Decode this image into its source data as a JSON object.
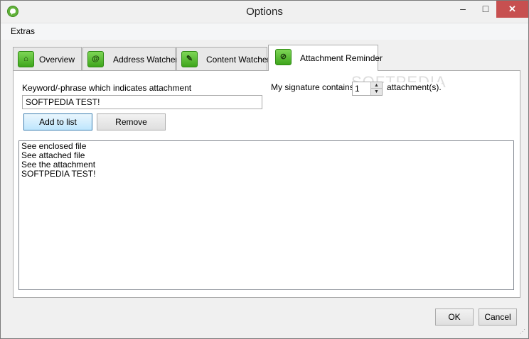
{
  "window": {
    "title": "Options",
    "close_glyph": "✕",
    "minimize_glyph": "–",
    "maximize_glyph": "□"
  },
  "menu": {
    "items": [
      {
        "label": "Extras"
      }
    ]
  },
  "tabs": [
    {
      "label": "Overview",
      "icon": "home-icon",
      "glyph": "⌂",
      "active": false
    },
    {
      "label": "Address Watcher",
      "icon": "at-icon",
      "glyph": "@",
      "active": false
    },
    {
      "label": "Content Watcher",
      "icon": "edit-icon",
      "glyph": "✎",
      "active": false
    },
    {
      "label": "Attachment Reminder",
      "icon": "paperclip-icon",
      "glyph": "⊘",
      "active": true
    }
  ],
  "attachment": {
    "keyword_label": "Keyword/-phrase which indicates attachment",
    "keyword_value": "SOFTPEDIA TEST!",
    "add_button": "Add to list",
    "remove_button": "Remove",
    "signature_label": "My signature contains",
    "signature_count": "1",
    "signature_suffix": "attachment(s).",
    "spin_up_glyph": "▲",
    "spin_down_glyph": "▼",
    "watermark": "SOFTPEDIA",
    "list": [
      "See enclosed file",
      "See attached file",
      "See the attachment",
      "SOFTPEDIA TEST!"
    ]
  },
  "footer": {
    "ok": "OK",
    "cancel": "Cancel"
  },
  "colors": {
    "accent_green": "#62b33a",
    "close_red": "#c75050",
    "focus_blue": "#3c7fb1"
  }
}
